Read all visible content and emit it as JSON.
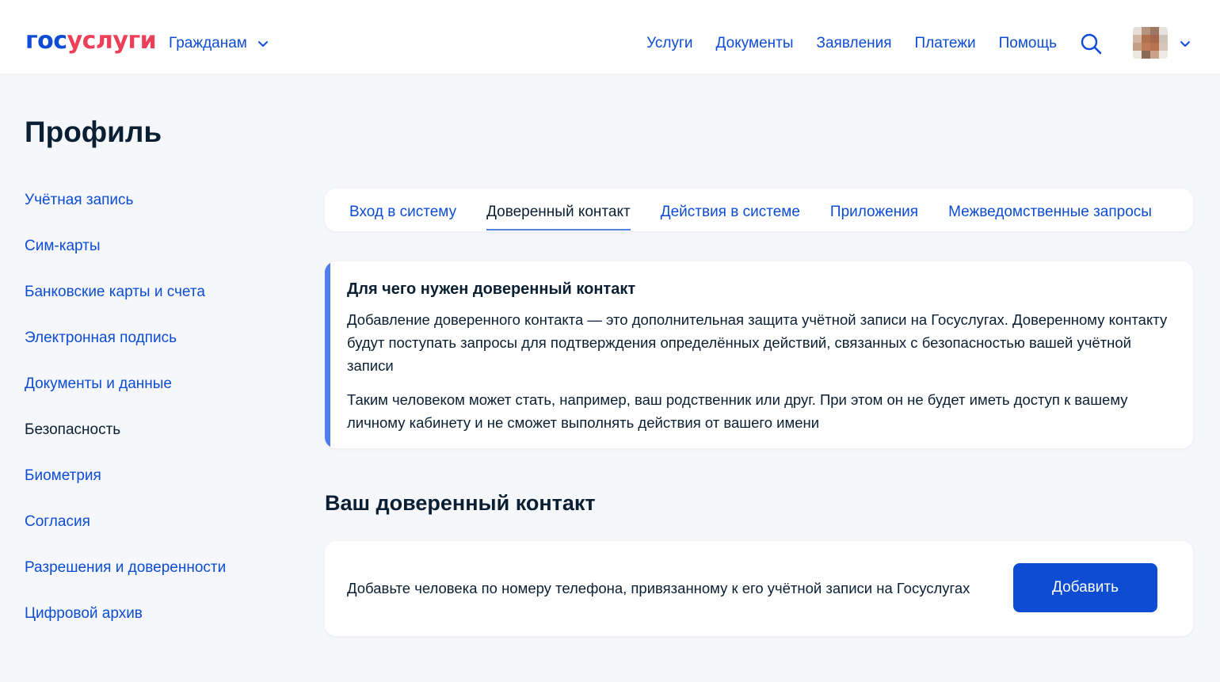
{
  "header": {
    "logo_part1": "гос",
    "logo_part2": "услуги",
    "audience_label": "Гражданам",
    "nav": [
      "Услуги",
      "Документы",
      "Заявления",
      "Платежи",
      "Помощь"
    ],
    "search_icon": "search-icon",
    "brand_blue": "#0d4cd3",
    "brand_red": "#ee3f58"
  },
  "page": {
    "title": "Профиль"
  },
  "sidebar": {
    "items": [
      "Учётная запись",
      "Сим-карты",
      "Банковские карты и счета",
      "Электронная подпись",
      "Документы и данные",
      "Безопасность",
      "Биометрия",
      "Согласия",
      "Разрешения и доверенности",
      "Цифровой архив"
    ],
    "active_item": "Безопасность"
  },
  "tabs": {
    "items": [
      "Вход в систему",
      "Доверенный контакт",
      "Действия в системе",
      "Приложения",
      "Межведомственные запросы"
    ],
    "active": "Доверенный контакт"
  },
  "info": {
    "title": "Для чего нужен доверенный контакт",
    "paragraph1": "Добавление доверенного контакта — это дополнительная защита учётной записи на Госуслугах. Доверенному контакту будут поступать запросы для подтверждения определённых действий, связанных с безопасностью вашей учётной записи",
    "paragraph2": "Таким человеком может стать, например, ваш родственник или друг. При этом он не будет иметь доступ к вашему личному кабинету и не сможет выполнять действия от вашего имени",
    "accent_color": "#4f7ef1"
  },
  "contact": {
    "section_title": "Ваш доверенный контакт",
    "text": "Добавьте человека по номеру телефона, привязанному к его учётной записи на Госуслугах",
    "add_button": "Добавить"
  }
}
